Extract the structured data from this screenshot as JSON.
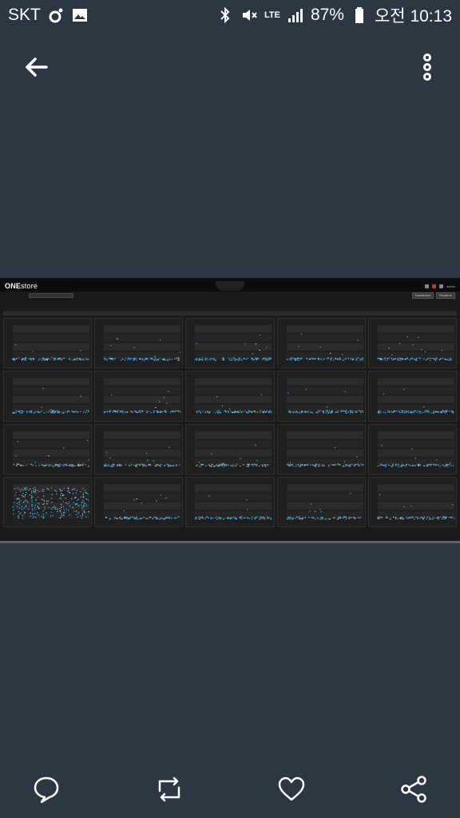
{
  "status_bar": {
    "carrier": "SKT",
    "network": "LTE",
    "battery": "87%",
    "time": "오전 10:13",
    "icons": [
      "o-icon",
      "gallery-icon",
      "bluetooth-icon",
      "mute-icon",
      "lte-icon",
      "signal-icon",
      "battery-icon"
    ]
  },
  "top_bar": {
    "back_icon": "arrow-left-icon",
    "more_icon": "three-dots-vertical-icon"
  },
  "screenshot": {
    "logo_bold": "ONE",
    "logo_light": "store",
    "user": "admin",
    "buttons": [
      "Dashboard",
      "Realtime"
    ],
    "panel_rows": 4,
    "panel_cols": 5
  },
  "nav_bar": {
    "icons": [
      "comment-icon",
      "retweet-icon",
      "heart-icon",
      "share-icon"
    ]
  },
  "colors": {
    "background": "#2c3743",
    "screenshot_bg": "#1a1a1a",
    "scatter_dot": "#4da3d9"
  }
}
